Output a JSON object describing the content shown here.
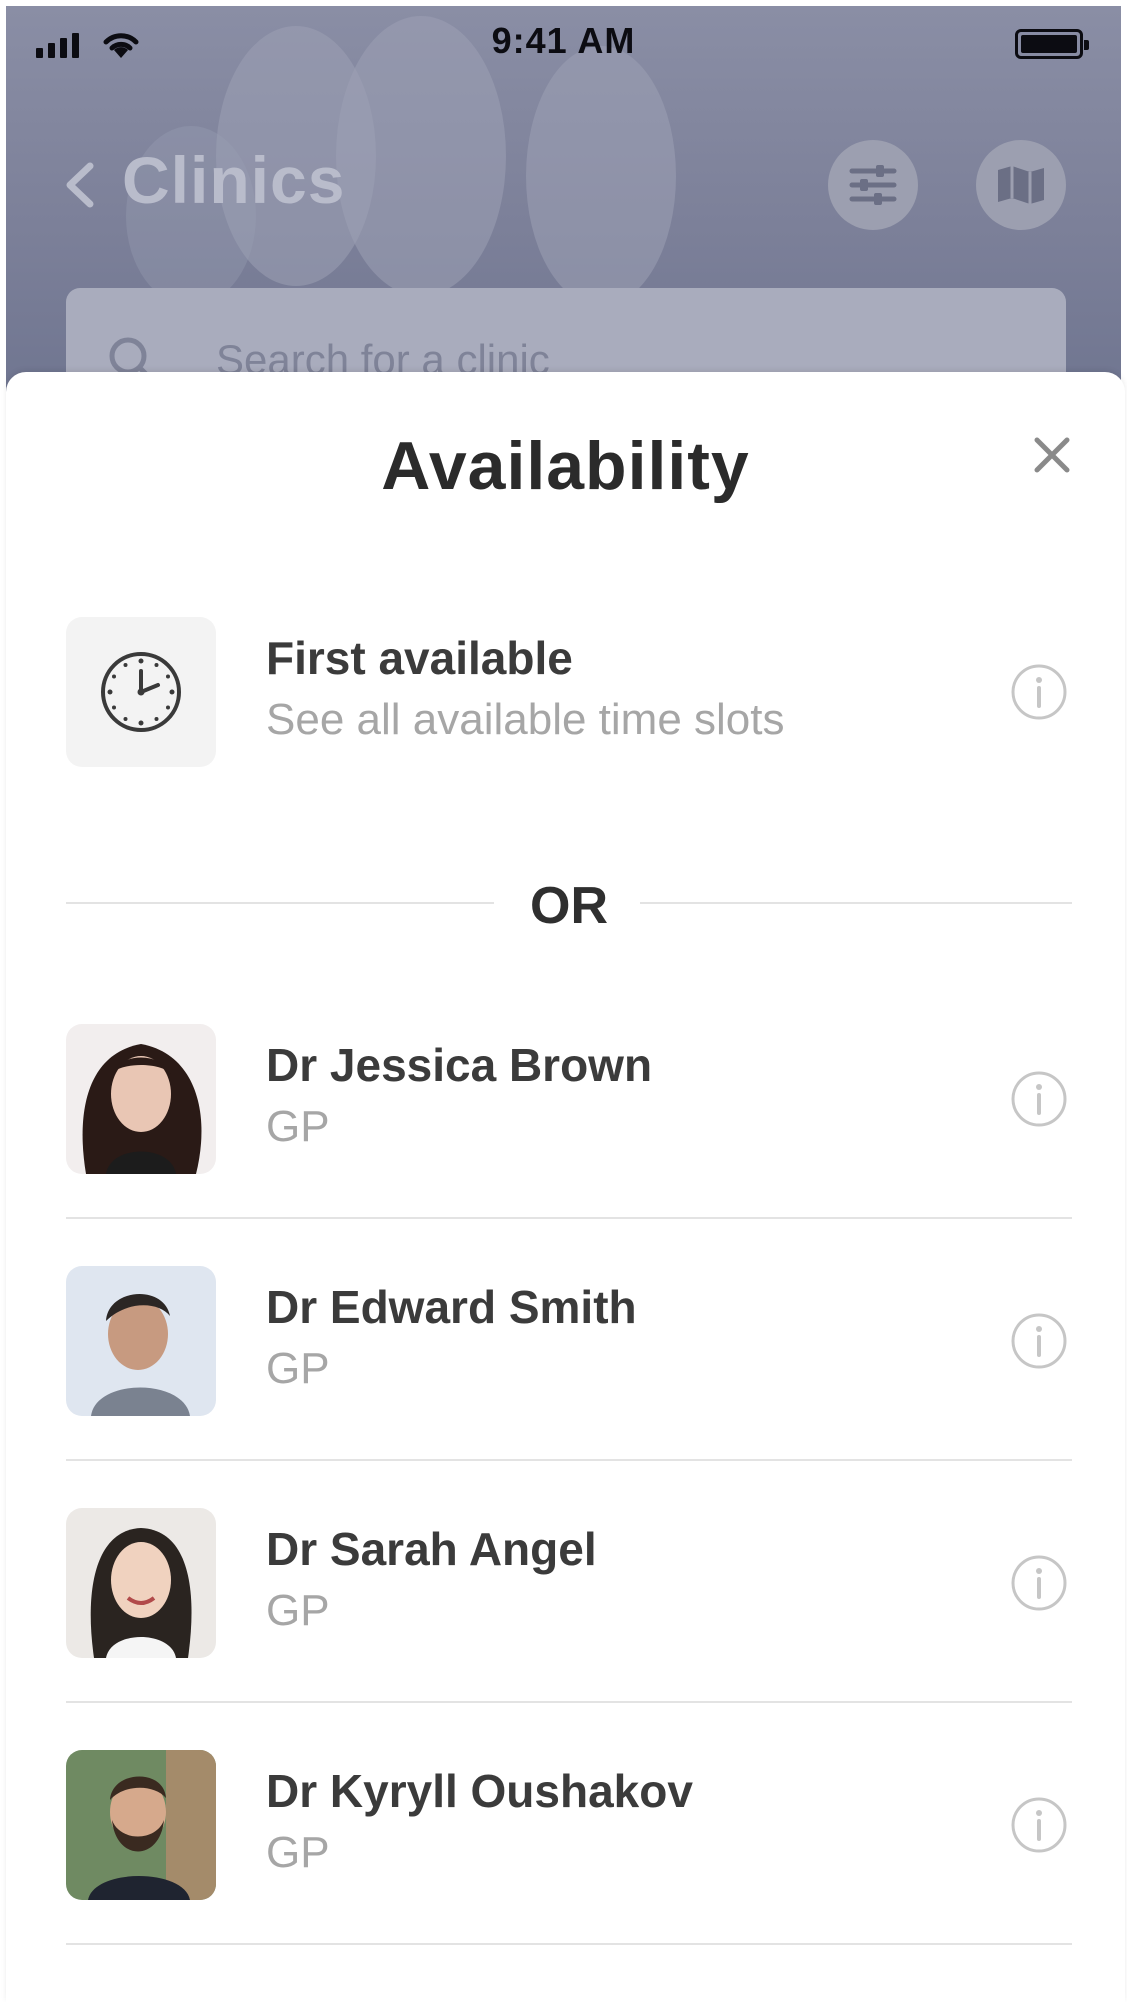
{
  "status_bar": {
    "time": "9:41 AM"
  },
  "header": {
    "title": "Clinics",
    "search": {
      "placeholder": "Search for a clinic"
    }
  },
  "sheet": {
    "title": "Availability",
    "first_available": {
      "name": "First available",
      "subtitle": "See all available time slots"
    },
    "separator": "OR",
    "doctors": [
      {
        "name": "Dr Jessica Brown",
        "role": "GP"
      },
      {
        "name": "Dr Edward Smith",
        "role": "GP"
      },
      {
        "name": "Dr Sarah Angel",
        "role": "GP"
      },
      {
        "name": "Dr Kyryll Oushakov",
        "role": "GP"
      }
    ]
  },
  "colors": {
    "overlay": "#7c8099",
    "text_primary": "#3b3b3b",
    "text_secondary": "#a6a6a6",
    "divider": "#e3e3e3"
  },
  "icons": [
    "signal-icon",
    "wifi-icon",
    "battery-icon",
    "back-chevron-icon",
    "filter-sliders-icon",
    "map-icon",
    "search-icon",
    "close-icon",
    "clock-icon",
    "info-icon"
  ]
}
